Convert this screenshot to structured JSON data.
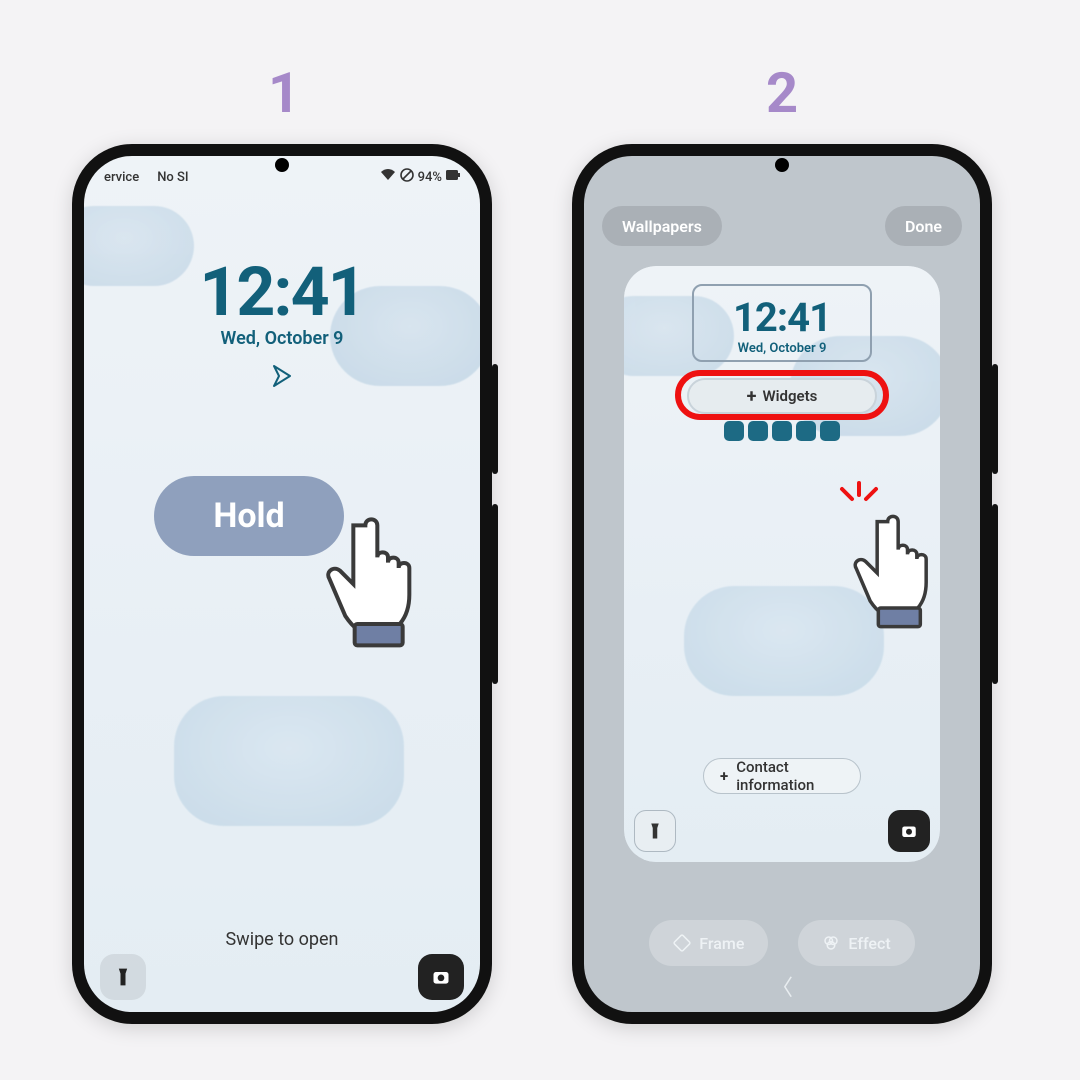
{
  "steps": {
    "one": "1",
    "two": "2"
  },
  "phone1": {
    "status": {
      "left1": "ervice",
      "left2": "No SI",
      "battery": "94%"
    },
    "time": "12:41",
    "date": "Wed, October 9",
    "hold_label": "Hold",
    "swipe": "Swipe to open"
  },
  "phone2": {
    "wallpapers_btn": "Wallpapers",
    "done_btn": "Done",
    "time": "12:41",
    "date": "Wed, October 9",
    "widgets_btn": "Widgets",
    "contact_btn": "Contact information",
    "frame_btn": "Frame",
    "effect_btn": "Effect"
  },
  "colors": {
    "accent": "#12607a",
    "step": "#a689c9",
    "hold": "#8fa0bd",
    "highlight_ring": "#ee1111"
  }
}
